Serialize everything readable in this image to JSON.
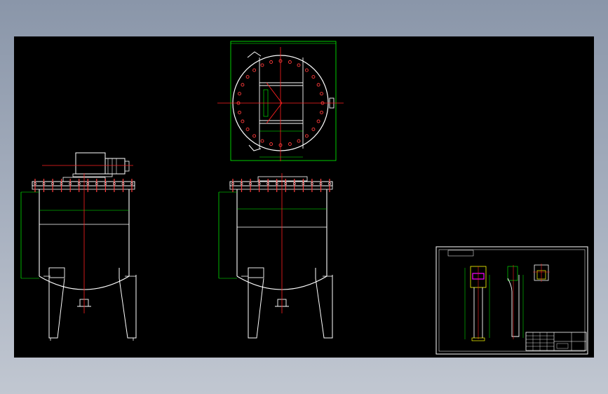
{
  "app": {
    "viewport_background": "#8e99ab",
    "canvas_background": "#000000"
  },
  "drawing": {
    "colors": {
      "outline": "#ffffff",
      "centerline": "#ff2020",
      "dimension": "#00ff00",
      "bolt": "#ff3b3b",
      "highlight": "#ff00ff",
      "accent": "#ffff00"
    },
    "views": [
      {
        "id": "top-view",
        "type": "plan",
        "feature": "flange-with-bolt-circle"
      },
      {
        "id": "front-view-with-motor",
        "type": "elevation",
        "feature": "vessel-with-agitator-motor"
      },
      {
        "id": "front-view-section",
        "type": "elevation",
        "feature": "vessel-with-manway"
      },
      {
        "id": "detail-sheet",
        "type": "detail",
        "feature": "leg-and-bracket-details"
      }
    ],
    "title_block": {
      "present": true
    }
  }
}
